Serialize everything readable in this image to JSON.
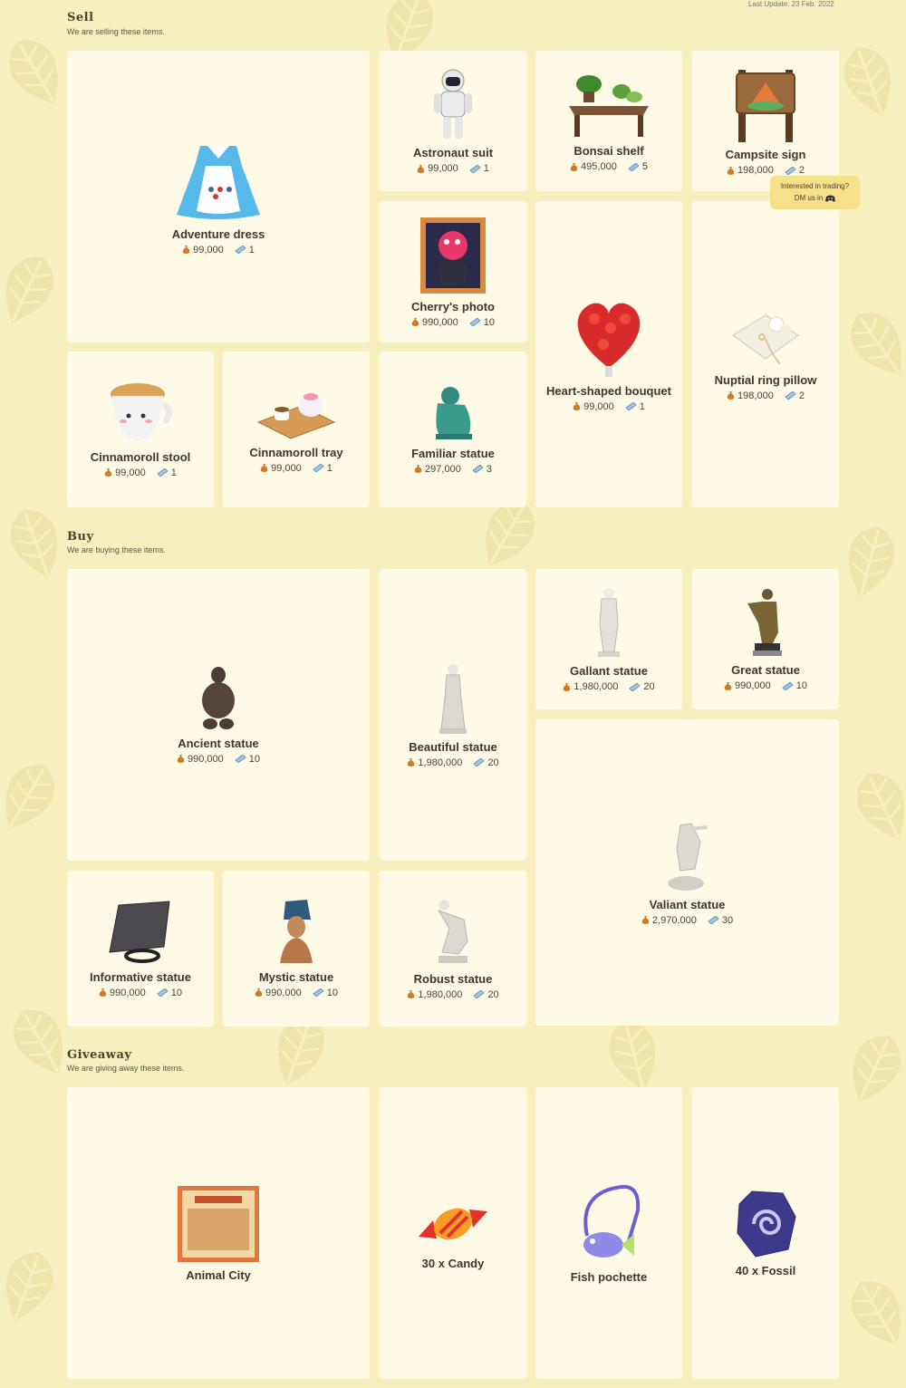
{
  "last_update": "Last Update: 23 Feb. 2022",
  "tooltip": {
    "line1": "Interested in trading?",
    "line2": "DM us in",
    "icon": "discord-icon"
  },
  "sections": {
    "sell": {
      "title": "Sell",
      "subtitle": "We are selling these items.",
      "items": [
        {
          "name": "Adventure dress",
          "bells": "99,000",
          "tickets": "1"
        },
        {
          "name": "Astronaut suit",
          "bells": "99,000",
          "tickets": "1"
        },
        {
          "name": "Bonsai shelf",
          "bells": "495,000",
          "tickets": "5"
        },
        {
          "name": "Campsite sign",
          "bells": "198,000",
          "tickets": "2"
        },
        {
          "name": "Cherry's photo",
          "bells": "990,000",
          "tickets": "10"
        },
        {
          "name": "Heart-shaped bouquet",
          "bells": "99,000",
          "tickets": "1"
        },
        {
          "name": "Nuptial ring pillow",
          "bells": "198,000",
          "tickets": "2"
        },
        {
          "name": "Cinnamoroll stool",
          "bells": "99,000",
          "tickets": "1"
        },
        {
          "name": "Cinnamoroll tray",
          "bells": "99,000",
          "tickets": "1"
        },
        {
          "name": "Familiar statue",
          "bells": "297,000",
          "tickets": "3"
        }
      ]
    },
    "buy": {
      "title": "Buy",
      "subtitle": "We are buying these items.",
      "items": [
        {
          "name": "Ancient statue",
          "bells": "990,000",
          "tickets": "10"
        },
        {
          "name": "Beautiful statue",
          "bells": "1,980,000",
          "tickets": "20"
        },
        {
          "name": "Gallant statue",
          "bells": "1,980,000",
          "tickets": "20"
        },
        {
          "name": "Great statue",
          "bells": "990,000",
          "tickets": "10"
        },
        {
          "name": "Valiant statue",
          "bells": "2,970,000",
          "tickets": "30"
        },
        {
          "name": "Informative statue",
          "bells": "990,000",
          "tickets": "10"
        },
        {
          "name": "Mystic statue",
          "bells": "990,000",
          "tickets": "10"
        },
        {
          "name": "Robust statue",
          "bells": "1,980,000",
          "tickets": "20"
        }
      ]
    },
    "giveaway": {
      "title": "Giveaway",
      "subtitle": "We are giving away these items.",
      "items": [
        {
          "name": "Animal City"
        },
        {
          "name": "30 x Candy"
        },
        {
          "name": "Fish pochette"
        },
        {
          "name": "40 x Fossil"
        }
      ]
    }
  },
  "icons": {
    "bells": "bell-bag-icon",
    "tickets": "nook-miles-ticket-icon"
  },
  "colors": {
    "background": "#f8efbe",
    "card": "#fffae6",
    "tooltip": "#f6e08a",
    "leaf": "#efe2a8"
  }
}
